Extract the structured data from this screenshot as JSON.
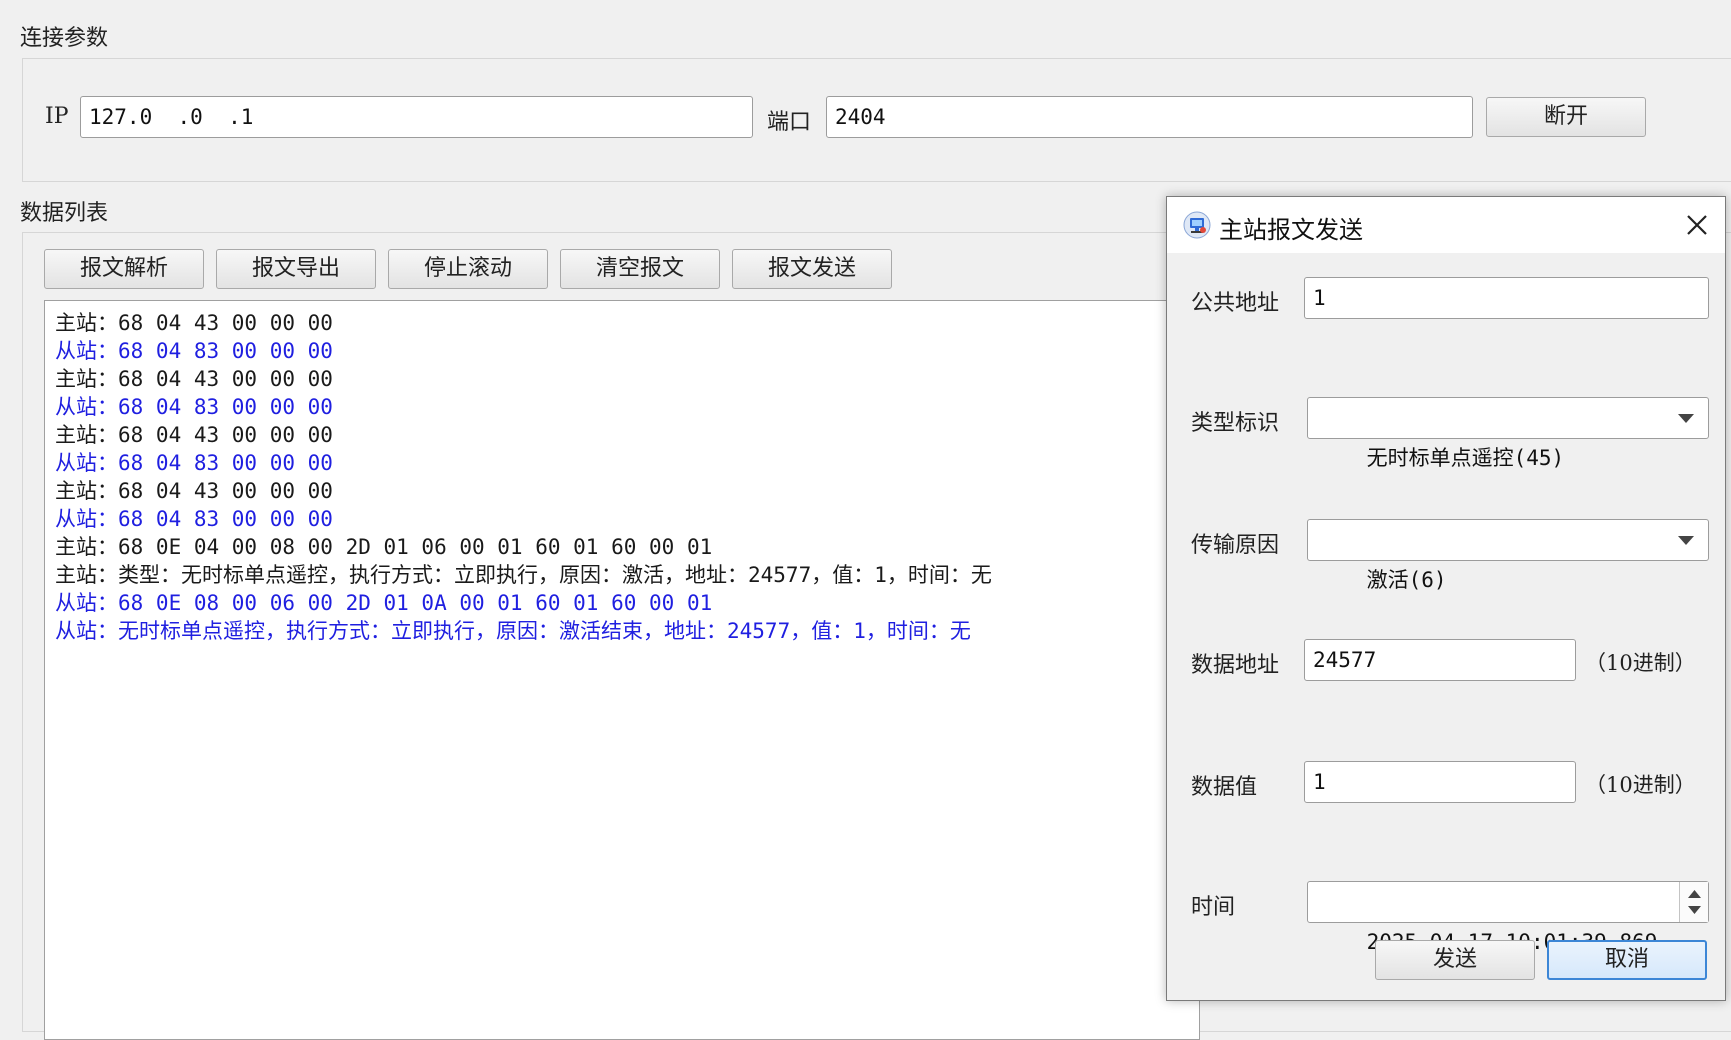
{
  "connection": {
    "title": "连接参数",
    "ip_label": "IP",
    "ip_value": "127.0  .0  .1",
    "port_label": "端口",
    "port_value": "2404",
    "disconnect_label": "断开"
  },
  "data_list": {
    "title": "数据列表",
    "buttons": [
      "报文解析",
      "报文导出",
      "停止滚动",
      "清空报文",
      "报文发送"
    ],
    "lines": [
      {
        "text": "主站：68 04 43 00 00 00",
        "color": "#1a1a1a"
      },
      {
        "text": "从站：68 04 83 00 00 00",
        "color": "#1f1fe0"
      },
      {
        "text": "主站：68 04 43 00 00 00",
        "color": "#1a1a1a"
      },
      {
        "text": "从站：68 04 83 00 00 00",
        "color": "#1f1fe0"
      },
      {
        "text": "主站：68 04 43 00 00 00",
        "color": "#1a1a1a"
      },
      {
        "text": "从站：68 04 83 00 00 00",
        "color": "#1f1fe0"
      },
      {
        "text": "主站：68 04 43 00 00 00",
        "color": "#1a1a1a"
      },
      {
        "text": "从站：68 04 83 00 00 00",
        "color": "#1f1fe0"
      },
      {
        "text": "主站：68 0E 04 00 08 00 2D 01 06 00 01 60 01 60 00 01",
        "color": "#1a1a1a"
      },
      {
        "text": "主站：类型：无时标单点遥控，执行方式：立即执行，原因：激活，地址：24577，值：1，时间：无",
        "color": "#1a1a1a"
      },
      {
        "text": "从站：68 0E 08 00 06 00 2D 01 0A 00 01 60 01 60 00 01",
        "color": "#1f1fe0"
      },
      {
        "text": "从站：无时标单点遥控，执行方式：立即执行，原因：激活结束，地址：24577，值：1，时间：无",
        "color": "#1f1fe0"
      }
    ]
  },
  "dialog": {
    "title": "主站报文发送",
    "icon": "network-computer-icon",
    "close_icon": "close-icon",
    "common_address_label": "公共地址",
    "common_address_value": "1",
    "type_label": "类型标识",
    "type_value": "无时标单点遥控(45)",
    "cause_label": "传输原因",
    "cause_value": "激活(6)",
    "data_address_label": "数据地址",
    "data_address_value": "24577",
    "data_address_unit": "（10进制）",
    "data_value_label": "数据值",
    "data_value_value": "1",
    "data_value_unit": "（10进制）",
    "time_label": "时间",
    "time_value": "2025-04-17 10:01:39.869",
    "send_label": "发送",
    "cancel_label": "取消"
  }
}
